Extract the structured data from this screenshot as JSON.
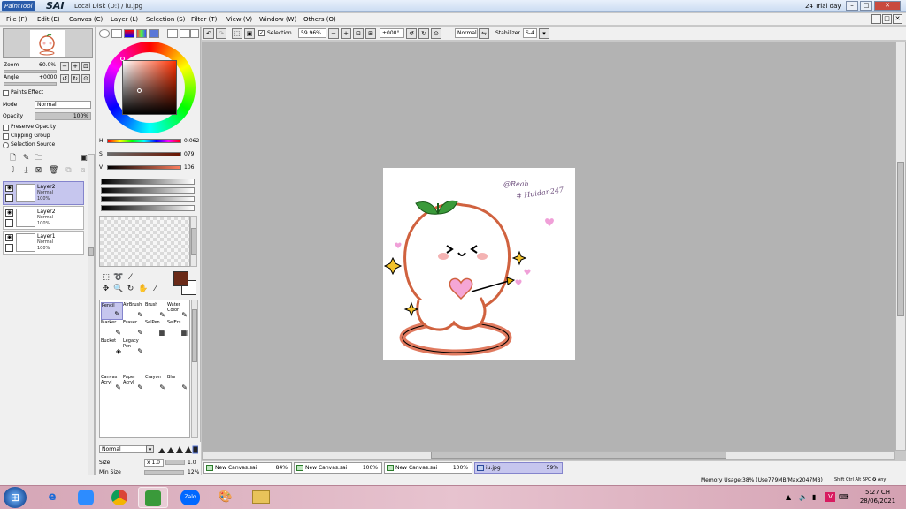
{
  "title_bar": {
    "app_logo": "PaintTool",
    "app_name": "SAI",
    "path": "Local Disk (D:) / iu.jpg",
    "trial": "24 Trial day",
    "min": "–",
    "max": "□",
    "close": "✕"
  },
  "menu": [
    "File (F)",
    "Edit (E)",
    "Canvas (C)",
    "Layer (L)",
    "Selection (S)",
    "Filter (T)",
    "View (V)",
    "Window (W)",
    "Others (O)"
  ],
  "navigator": {
    "zoom_label": "Zoom",
    "zoom_value": "60.0%",
    "angle_label": "Angle",
    "angle_value": "+0000"
  },
  "layer_panel": {
    "paint_effect": "Paints Effect",
    "mode_label": "Mode",
    "mode_value": "Normal",
    "opacity_label": "Opacity",
    "opacity_value": "100%",
    "preserve_opacity": "Preserve Opacity",
    "clipping_group": "Clipping Group",
    "selection_source": "Selection Source",
    "layers": [
      {
        "name": "Layer2",
        "mode": "Normal",
        "opacity": "100%",
        "selected": true
      },
      {
        "name": "Layer2",
        "mode": "Normal",
        "opacity": "100%",
        "selected": false
      },
      {
        "name": "Layer1",
        "mode": "Normal",
        "opacity": "100%",
        "selected": false
      }
    ]
  },
  "color_panel": {
    "h_label": "H",
    "h_value": "0:062",
    "s_label": "S",
    "s_value": "079",
    "v_label": "V",
    "v_value": "106",
    "main_color": "#6a2a18",
    "sub_color": "#ffffff"
  },
  "brushes": [
    {
      "name": "Pencil",
      "icon": "pencil-icon",
      "selected": true
    },
    {
      "name": "AirBrush",
      "icon": "airbrush-icon",
      "selected": false
    },
    {
      "name": "Brush",
      "icon": "brush-icon",
      "selected": false
    },
    {
      "name": "Water Color",
      "icon": "watercolor-icon",
      "selected": false
    },
    {
      "name": "Marker",
      "icon": "marker-icon",
      "selected": false
    },
    {
      "name": "Eraser",
      "icon": "eraser-icon",
      "selected": false
    },
    {
      "name": "SelPen",
      "icon": "selpen-icon",
      "selected": false
    },
    {
      "name": "SelErs",
      "icon": "selers-icon",
      "selected": false
    },
    {
      "name": "Bucket",
      "icon": "bucket-icon",
      "selected": false
    },
    {
      "name": "Legacy Pen",
      "icon": "legacy-pen-icon",
      "selected": false
    },
    {
      "name": "Canvas Acryl",
      "icon": "canvas-acryl-icon",
      "selected": false
    },
    {
      "name": "Paper Acryl",
      "icon": "paper-acryl-icon",
      "selected": false
    },
    {
      "name": "Crayon",
      "icon": "crayon-icon",
      "selected": false
    },
    {
      "name": "Blur",
      "icon": "blur-icon",
      "selected": false
    }
  ],
  "brush_settings": {
    "mode": "Normal",
    "size_label": "Size",
    "size_mult": "x 1.0",
    "size_value": "1.0",
    "min_size_label": "Min Size",
    "min_size_value": "12%"
  },
  "toolbar": {
    "selection_label": "Selection",
    "zoom": "59.96%",
    "angle": "+000°",
    "mode": "Normal",
    "stabilizer_label": "Stabilizer",
    "stabilizer_value": "S-4"
  },
  "canvas_tabs": [
    {
      "name": "New Canvas.sai",
      "zoom": "84%",
      "selected": false
    },
    {
      "name": "New Canvas.sai",
      "zoom": "100%",
      "selected": false
    },
    {
      "name": "New Canvas.sai",
      "zoom": "100%",
      "selected": false
    },
    {
      "name": "iu.jpg",
      "zoom": "59%",
      "selected": true
    }
  ],
  "status": {
    "memory": "Memory Usage:38% (Use779MB/Max2047MB)",
    "keys": "Shift Ctrl Alt SPC ✪ Any"
  },
  "canvas_text": {
    "signature_1": "@Reah",
    "signature_2": "# Huidan247"
  },
  "taskbar": {
    "clock_time": "5:27 CH",
    "clock_date": "28/06/2021",
    "apps": [
      "start",
      "ie",
      "zoom",
      "chrome",
      "sai",
      "zalo",
      "paint",
      "explorer"
    ],
    "zalo_label": "Zalo"
  }
}
